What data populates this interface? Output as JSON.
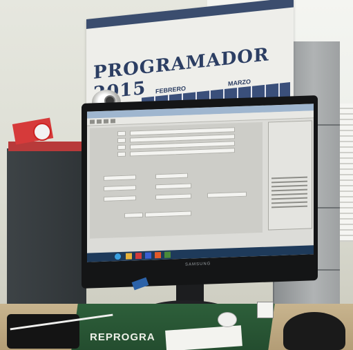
{
  "calendar": {
    "title": "PROGRAMADOR 2015",
    "month_left": "FEBRERO",
    "month_right": "MARZO"
  },
  "monitor": {
    "brand": "SAMSUNG"
  },
  "box": {
    "text": "REPROGRA"
  },
  "colors": {
    "calendar_blue": "#2c3e63",
    "box_green": "#2d5f3a",
    "taskbar": "#1e3a5a"
  }
}
